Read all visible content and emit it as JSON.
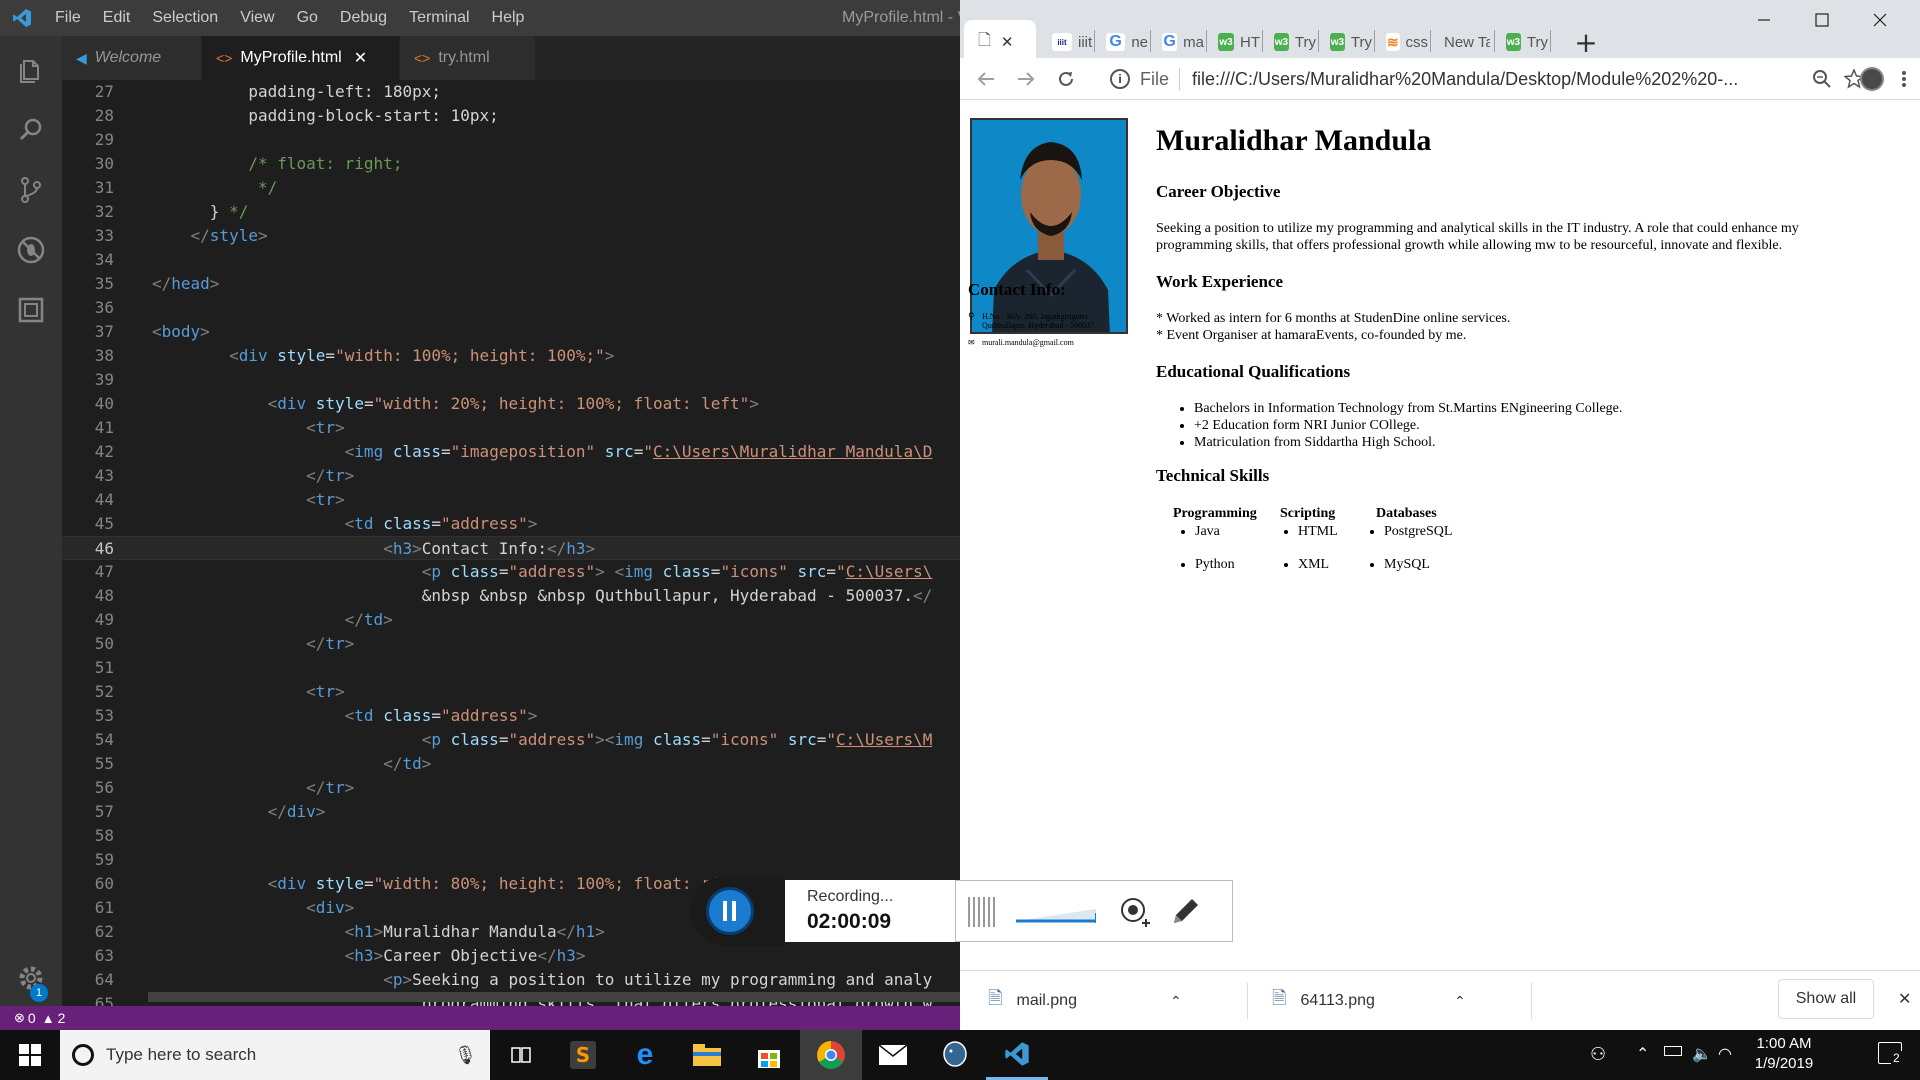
{
  "vscode": {
    "menu": [
      "File",
      "Edit",
      "Selection",
      "View",
      "Go",
      "Debug",
      "Terminal",
      "Help"
    ],
    "title": "MyProfile.html - V",
    "tabs": [
      {
        "label": "Welcome",
        "icon": "vscode-icon"
      },
      {
        "label": "MyProfile.html",
        "icon": "html-icon",
        "close": "✕"
      },
      {
        "label": "try.html",
        "icon": "html-icon"
      }
    ],
    "status": {
      "errors": "0",
      "warnings": "2"
    },
    "settings_badge": "1",
    "line_numbers": [
      "27",
      "28",
      "29",
      "30",
      "31",
      "32",
      "33",
      "34",
      "35",
      "36",
      "37",
      "38",
      "39",
      "40",
      "41",
      "42",
      "43",
      "44",
      "45",
      "46",
      "47",
      "48",
      "49",
      "50",
      "51",
      "52",
      "53",
      "54",
      "55",
      "56",
      "57",
      "58",
      "59",
      "60",
      "61",
      "62",
      "63",
      "64",
      "65"
    ]
  },
  "chrome": {
    "tabs": [
      {
        "label": "",
        "favicon": "page-icon",
        "close": "✕"
      },
      {
        "label": "iiit",
        "favicon": "iiit-icon"
      },
      {
        "label": "ne",
        "favicon": "google-icon"
      },
      {
        "label": "ma",
        "favicon": "google-icon"
      },
      {
        "label": "HT",
        "favicon": "w3-icon"
      },
      {
        "label": "Try",
        "favicon": "w3-icon"
      },
      {
        "label": "Try",
        "favicon": "w3-icon"
      },
      {
        "label": "css",
        "favicon": "so-icon"
      },
      {
        "label": "New Ta",
        "favicon": ""
      },
      {
        "label": "Try",
        "favicon": "w3-icon"
      }
    ],
    "new_tab": "+",
    "omnibox": {
      "scheme": "File",
      "url": "file:///C:/Users/Muralidhar%20Mandula/Desktop/Module%202%20-..."
    },
    "colors": {
      "tabstrip": "#dee1e6",
      "w3": "#4caf50"
    }
  },
  "profile": {
    "name": "Muralidhar Mandula",
    "contact_heading": "Contact Info:",
    "address_line1": "H.No : 36A- 260, Jagathgirigutta",
    "address_line2": "Quthbullapur, Hyderabad - 500037.",
    "email": "murali.mandula@gmail.com",
    "career_heading": "Career Objective",
    "career_text": "Seeking a position to utilize my programming and analytical skills in the IT industry. A role that could enhance my programming skills, that offers professional growth while allowing mw to be resourceful, innovate and flexible.",
    "work_heading": "Work Experience",
    "work_items": [
      "* Worked as intern for 6 months at StudenDine online services.",
      "* Event Organiser at hamaraEvents, co-founded by me."
    ],
    "edu_heading": "Educational Qualifications",
    "edu_items": [
      "Bachelors in Information Technology from St.Martins ENgineering College.",
      "+2 Education form NRI Junior COllege.",
      "Matriculation from Siddartha High School."
    ],
    "tech_heading": "Technical Skills",
    "skills": {
      "headers": [
        "Programming",
        "Scripting",
        "Databases"
      ],
      "row1": [
        "Java",
        "HTML",
        "PostgreSQL"
      ],
      "row2": [
        "Python",
        "XML",
        "MySQL"
      ]
    }
  },
  "downloads": {
    "items": [
      "mail.png",
      "64113.png"
    ],
    "show_all": "Show all",
    "close": "✕"
  },
  "recorder": {
    "status": "Recording...",
    "time": "02:00:09"
  },
  "taskbar": {
    "search_placeholder": "Type here to search",
    "time": "1:00 AM",
    "date": "1/9/2019",
    "notification_count": "2"
  }
}
